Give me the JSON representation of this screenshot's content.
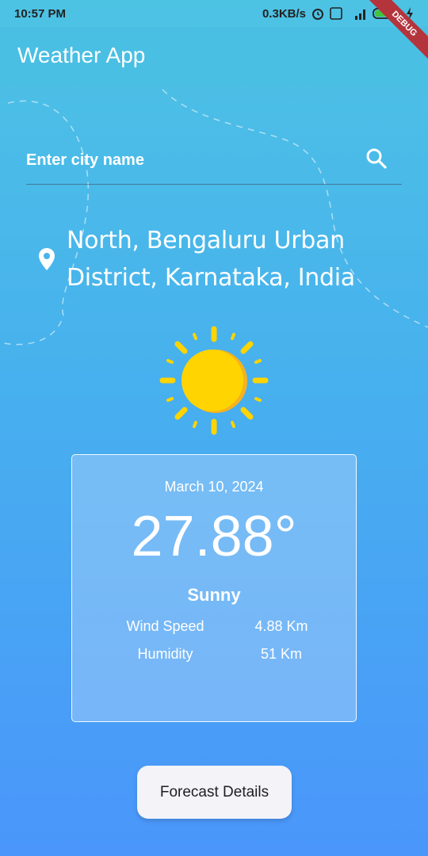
{
  "status_bar": {
    "time": "10:57 PM",
    "speed": "0.3KB/s",
    "battery": "45"
  },
  "app_bar": {
    "title": "Weather App",
    "debug_label": "DEBUG"
  },
  "search": {
    "placeholder": "Enter city name",
    "value": ""
  },
  "location": {
    "line1": "North, Bengaluru Urban",
    "line2": "District, Karnataka, India"
  },
  "weather": {
    "icon": "sun-icon",
    "date": "March 10, 2024",
    "temperature": "27.88°",
    "condition": "Sunny",
    "wind_label": "Wind Speed",
    "wind_value": "4.88 Km",
    "humidity_label": "Humidity",
    "humidity_value": "51 Km"
  },
  "actions": {
    "forecast_label": "Forecast Details"
  },
  "colors": {
    "accent_top": "#4dc3e4",
    "accent_bottom": "#4a96fb",
    "sun": "#ffd400",
    "sun_shade": "#f5a623",
    "debug_ribbon": "#b4343c"
  }
}
